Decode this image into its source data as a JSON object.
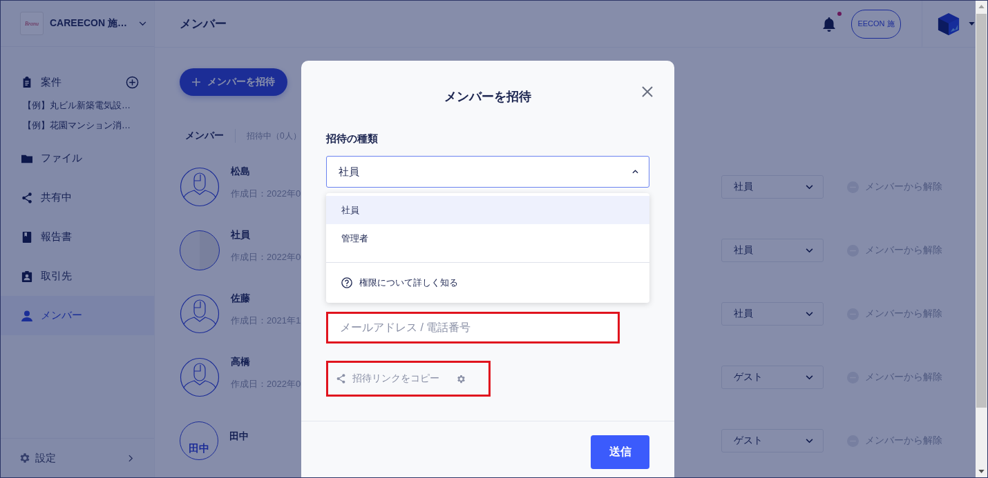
{
  "workspace": {
    "logo_text": "Branu",
    "name": "CAREECON 施…"
  },
  "page_title": "メンバー",
  "header": {
    "notification_unread": true,
    "company_logo_text": "EECON 施"
  },
  "sidebar": {
    "items": [
      {
        "label": "案件",
        "selected": false,
        "add_button": true,
        "children": [
          {
            "label": "【例】丸ビル新築電気設…"
          },
          {
            "label": "【例】花園マンション消…"
          }
        ]
      },
      {
        "label": "ファイル",
        "selected": false
      },
      {
        "label": "共有中",
        "selected": false
      },
      {
        "label": "報告書",
        "selected": false
      },
      {
        "label": "取引先",
        "selected": false
      },
      {
        "label": "メンバー",
        "selected": true
      }
    ],
    "settings": "設定"
  },
  "invite_button": "メンバーを招待",
  "tabs": [
    {
      "label": "メンバー",
      "selected": true
    },
    {
      "label": "招待中（0人）",
      "selected": false
    }
  ],
  "members": [
    {
      "name": "松島",
      "created": "作成日：2022年0",
      "avatar": {
        "kind": "silhouette"
      },
      "role": "社員",
      "remove": "メンバーから解除"
    },
    {
      "name": "社員",
      "created": "作成日：2022年0",
      "avatar": {
        "kind": "photo"
      },
      "role": "社員",
      "remove": "メンバーから解除"
    },
    {
      "name": "佐藤",
      "created": "作成日：2021年1",
      "avatar": {
        "kind": "silhouette"
      },
      "role": "社員",
      "remove": "メンバーから解除"
    },
    {
      "name": "高橋",
      "created": "作成日：2022年0",
      "avatar": {
        "kind": "silhouette"
      },
      "role": "ゲスト",
      "remove": "メンバーから解除"
    },
    {
      "name": "田中",
      "avatar": {
        "kind": "initials",
        "text": "田中"
      },
      "role": "ゲスト",
      "remove": "メンバーから解除"
    }
  ],
  "modal": {
    "title": "メンバーを招待",
    "type_label": "招待の種類",
    "type_select": {
      "value": "社員",
      "expanded": true,
      "options": [
        {
          "label": "社員",
          "selected": true
        },
        {
          "label": "管理者",
          "selected": false
        }
      ],
      "help_link": "権限について詳しく知る"
    },
    "contact_field": {
      "placeholder": "メールアドレス / 電話番号",
      "highlighted": true
    },
    "copy_link": {
      "label": "招待リンクをコピー",
      "highlighted": true
    },
    "send_button": "送信"
  }
}
